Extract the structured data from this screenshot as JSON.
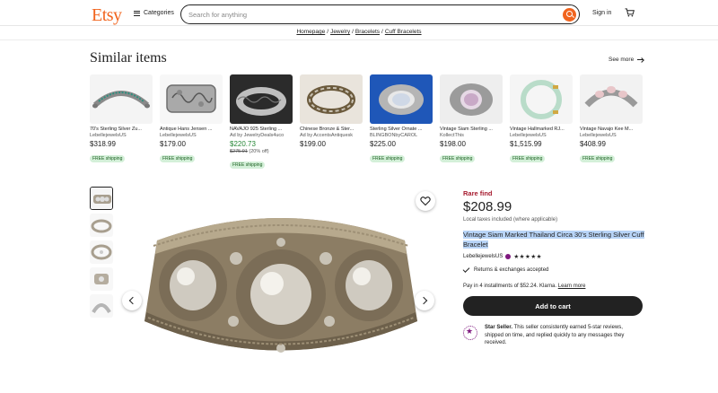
{
  "header": {
    "logo": "Etsy",
    "categories_label": "Categories",
    "search_placeholder": "Search for anything",
    "sign_in": "Sign in"
  },
  "breadcrumbs": [
    "Homepage",
    "Jewelry",
    "Bracelets",
    "Cuff Bracelets"
  ],
  "similar": {
    "title": "Similar items",
    "see_more": "See more",
    "items": [
      {
        "title": "70's Sterling Silver Zu...",
        "shop": "LebellejewelsUS",
        "price": "$318.99",
        "shipping": "FREE shipping"
      },
      {
        "title": "Antique Hans Jensen ...",
        "shop": "LebellejewelsUS",
        "price": "$179.00",
        "shipping": "FREE shipping"
      },
      {
        "title": "NAVAJO 925 Sterling ...",
        "shop": "Ad by JewelryDeals4uco",
        "price": "$220.73",
        "old_price": "$275.91",
        "discount": "(20% off)",
        "shipping": "FREE shipping"
      },
      {
        "title": "Chinese Bronze & Ster...",
        "shop": "Ad by AccentsAntiquesk",
        "price": "$199.00"
      },
      {
        "title": "Sterling Silver Ornate ...",
        "shop": "BLINGBONbyCAROL",
        "price": "$225.00",
        "shipping": "FREE shipping"
      },
      {
        "title": "Vintage Siam Sterling ...",
        "shop": "KollectThis",
        "price": "$198.00",
        "shipping": "FREE shipping"
      },
      {
        "title": "Vintage Hallmarked RJ...",
        "shop": "LebellejewelsUS",
        "price": "$1,515.99",
        "shipping": "FREE shipping"
      },
      {
        "title": "Vintage Navajo Kee M...",
        "shop": "LebellejewelsUS",
        "price": "$408.99",
        "shipping": "FREE shipping"
      }
    ]
  },
  "product": {
    "rare": "Rare find",
    "price": "$208.99",
    "tax_note": "Local taxes included (where applicable)",
    "title": "Vintage Siam Marked Thailand Circa 30's Sterling Silver Cuff Bracelet",
    "shop": "LebellejewelsUS",
    "stars": "★★★★★",
    "returns": "Returns & exchanges accepted",
    "installments": "Pay in 4 installments of $52.24. Klarna.",
    "learn_more": "Learn more",
    "add_to_cart": "Add to cart",
    "star_seller_label": "Star Seller.",
    "star_seller_text": "This seller consistently earned 5-star reviews, shipped on time, and replied quickly to any messages they received."
  },
  "colors": {
    "brand": "#F1641E",
    "sale_green": "#258635",
    "rare_red": "#A61A2E",
    "star_seller_purple": "#7F187F"
  }
}
